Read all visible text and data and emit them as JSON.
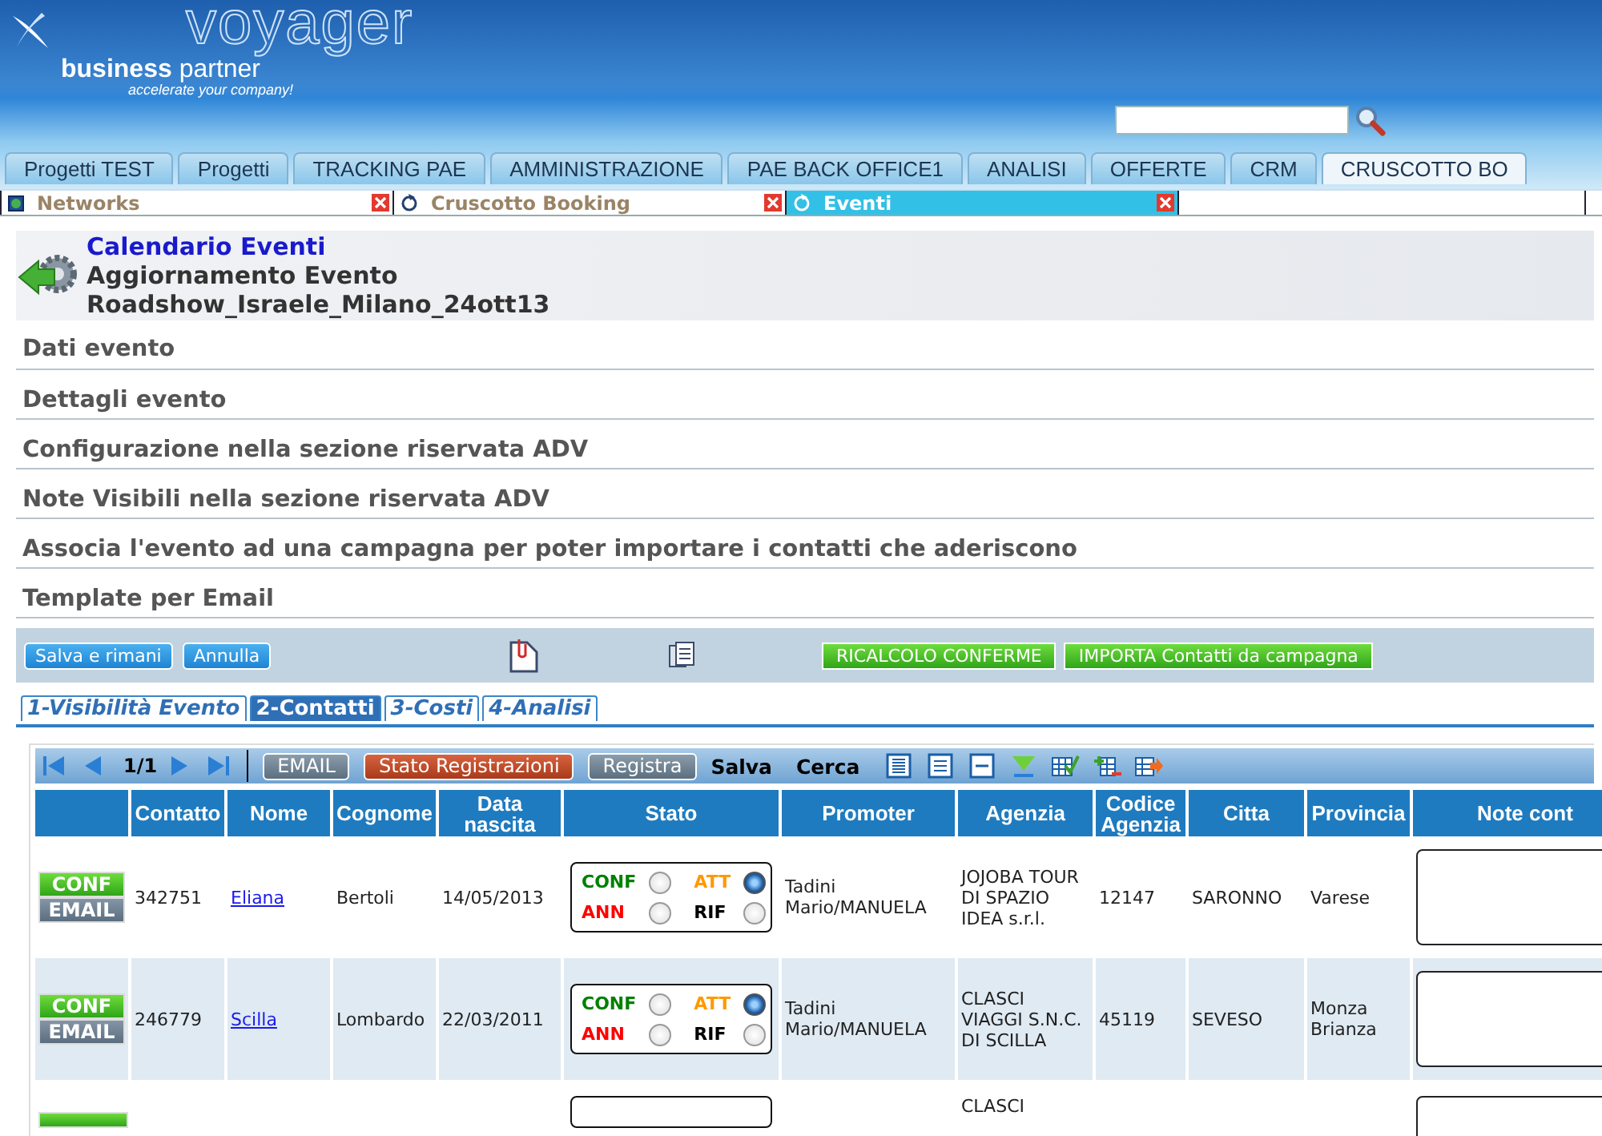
{
  "logo": {
    "brand": "voyager",
    "name_bold": "business",
    "name_rest": "partner",
    "tagline": "accelerate your company!"
  },
  "main_tabs": [
    {
      "label": "Progetti TEST",
      "selected": false
    },
    {
      "label": "Progetti",
      "selected": false
    },
    {
      "label": "TRACKING PAE",
      "selected": false
    },
    {
      "label": "AMMINISTRAZIONE",
      "selected": false
    },
    {
      "label": "PAE BACK OFFICE1",
      "selected": false
    },
    {
      "label": "ANALISI",
      "selected": false
    },
    {
      "label": "OFFERTE",
      "selected": false
    },
    {
      "label": "CRM",
      "selected": false
    },
    {
      "label": "CRUSCOTTO BO",
      "selected": true
    }
  ],
  "window_tabs": [
    {
      "label": "Networks",
      "selected": false
    },
    {
      "label": "Cruscotto Booking",
      "selected": false
    },
    {
      "label": "Eventi",
      "selected": true
    }
  ],
  "heading": {
    "title": "Calendario Eventi",
    "subtitle": "Aggiornamento Evento",
    "event": "Roadshow_Israele_Milano_24ott13"
  },
  "sections": [
    "Dati evento",
    "Dettagli evento",
    "Configurazione nella sezione riservata ADV",
    "Note Visibili nella sezione riservata ADV",
    "Associa l'evento ad una campagna per poter importare i contatti che aderiscono",
    "Template per Email"
  ],
  "actions": {
    "left": [
      "Salva e rimani",
      "Annulla"
    ],
    "right": [
      "RICALCOLO CONFERME",
      "IMPORTA Contatti da campagna"
    ]
  },
  "sub_tabs": [
    {
      "label": "1-Visibilità Evento",
      "selected": false
    },
    {
      "label": "2-Contatti",
      "selected": true
    },
    {
      "label": "3-Costi",
      "selected": false
    },
    {
      "label": "4-Analisi",
      "selected": false
    }
  ],
  "grid": {
    "pager": "1/1",
    "toolbar_buttons": [
      {
        "label": "EMAIL",
        "kind": "gray"
      },
      {
        "label": "Stato Registrazioni",
        "kind": "red"
      },
      {
        "label": "Registra",
        "kind": "gray"
      }
    ],
    "toolbar_links": [
      "Salva",
      "Cerca"
    ],
    "columns": [
      "",
      "Contatto",
      "Nome",
      "Cognome",
      "Data nascita",
      "Stato",
      "Promoter",
      "Agenzia",
      "Codice Agenzia",
      "Citta",
      "Provincia",
      "Note cont"
    ],
    "rows": [
      {
        "conf": "CONF",
        "email": "EMAIL",
        "contatto": "342751",
        "nome": "Eliana",
        "cognome": "Bertoli",
        "data": "14/05/2013",
        "stato": [
          {
            "label": "CONF",
            "color": "#008000",
            "selected": false
          },
          {
            "label": "ATT",
            "color": "#ff9900",
            "selected": true
          },
          {
            "label": "ANN",
            "color": "#ff0000",
            "selected": false
          },
          {
            "label": "RIF",
            "color": "#000000",
            "selected": false
          }
        ],
        "promoter": "Tadini Mario/MANUELA",
        "agenzia": "JOJOBA TOUR DI SPAZIO IDEA s.r.l.",
        "codice": "12147",
        "citta": "SARONNO",
        "provincia": "Varese"
      },
      {
        "conf": "CONF",
        "email": "EMAIL",
        "contatto": "246779",
        "nome": "Scilla",
        "cognome": "Lombardo",
        "data": "22/03/2011",
        "stato": [
          {
            "label": "CONF",
            "color": "#008000",
            "selected": false
          },
          {
            "label": "ATT",
            "color": "#ff9900",
            "selected": true
          },
          {
            "label": "ANN",
            "color": "#ff0000",
            "selected": false
          },
          {
            "label": "RIF",
            "color": "#000000",
            "selected": false
          }
        ],
        "promoter": "Tadini Mario/MANUELA",
        "agenzia": "CLASCI VIAGGI S.N.C. DI SCILLA",
        "codice": "45119",
        "citta": "SEVESO",
        "provincia": "Monza Brianza"
      },
      {
        "agenzia": "CLASCI"
      }
    ]
  }
}
